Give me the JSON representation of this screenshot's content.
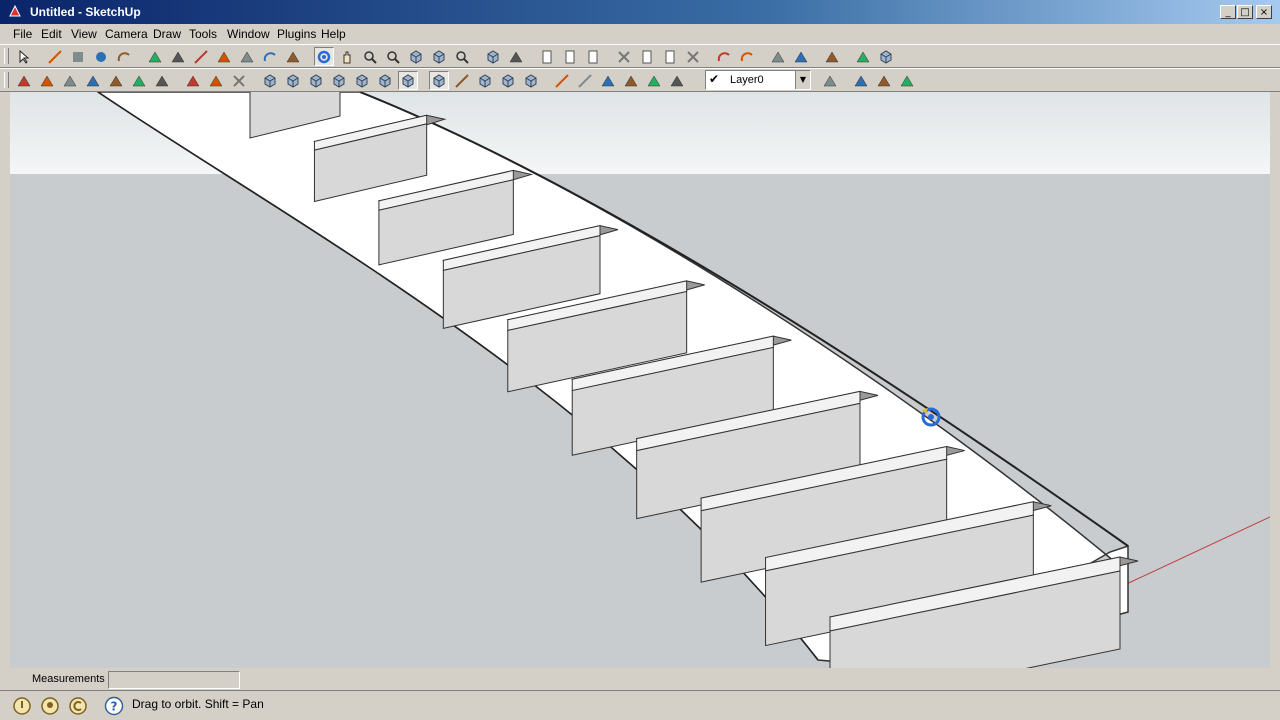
{
  "window": {
    "title": "Untitled - SketchUp",
    "controls": {
      "minimize": "_",
      "maximize": "□",
      "close": "×"
    }
  },
  "menu": [
    "File",
    "Edit",
    "View",
    "Camera",
    "Draw",
    "Tools",
    "Window",
    "Plugins",
    "Help"
  ],
  "toolbar_principal": {
    "tools": [
      "select-icon",
      "line-icon",
      "rectangle-icon",
      "circle-icon",
      "arc-icon",
      "eraser-icon",
      "paint-bucket-icon",
      "tape-measure-icon",
      "push-pull-icon",
      "move-icon",
      "rotate-icon",
      "offset-icon",
      "orbit-icon",
      "pan-icon",
      "zoom-icon",
      "zoom-extents-icon",
      "previous-view-icon",
      "next-view-icon",
      "zoom-window-icon",
      "components-icon",
      "materials-icon",
      "new-file-icon",
      "open-file-icon",
      "save-file-icon",
      "cut-icon",
      "copy-icon",
      "paste-icon",
      "delete-icon",
      "undo-icon",
      "redo-icon",
      "print-icon",
      "model-info-icon",
      "warehouse-icon",
      "share-icon",
      "dynamic-component-icon"
    ]
  },
  "toolbar_secondary": {
    "tools": [
      "sandbox-from-contours-icon",
      "sandbox-from-scratch-icon",
      "smoove-icon",
      "stamp-icon",
      "drape-icon",
      "add-detail-icon",
      "flip-edge-icon",
      "section-plane-icon",
      "section-display-icon",
      "section-cut-icon",
      "iso-view-icon",
      "top-view-icon",
      "front-view-icon",
      "right-view-icon",
      "back-view-icon",
      "left-view-icon",
      "xray-icon",
      "wireframe-icon",
      "hidden-line-icon",
      "shaded-icon",
      "textured-icon",
      "monochrome-icon",
      "tape-icon",
      "dimension-icon",
      "protractor-icon",
      "text-icon",
      "axes-icon",
      "3d-text-icon"
    ],
    "layer": {
      "checked": "✔",
      "name": "Layer0"
    },
    "after_layer": [
      "layer-manager-icon",
      "shadow-icon",
      "fog-icon",
      "soften-icon"
    ]
  },
  "measurements": {
    "label": "Measurements",
    "value": ""
  },
  "status": {
    "text": "Drag to orbit.  Shift = Pan"
  },
  "colors": {
    "sky": "#f0f3f4",
    "ground": "#c8ccce",
    "tread": "#8f8f8f",
    "stringer": "#ffffff"
  }
}
